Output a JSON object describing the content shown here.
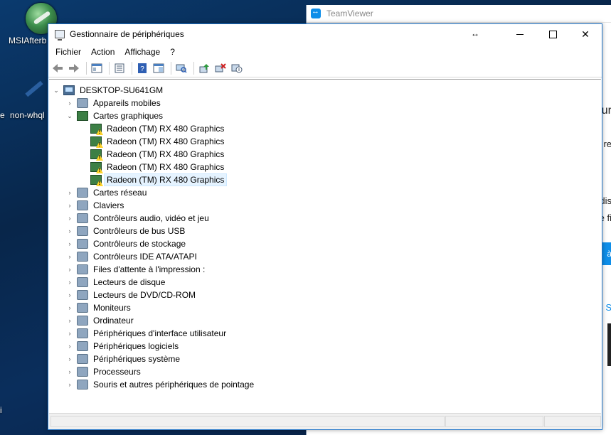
{
  "desktop": {
    "icons": [
      {
        "label": "MSIAfterb"
      },
      {
        "label": "non-whql"
      }
    ],
    "edge_letters": [
      "e",
      "i"
    ]
  },
  "teamviewer": {
    "title": "TeamViewer",
    "fragments": [
      "ur",
      "re",
      "dis",
      "e fi",
      "à",
      "- S"
    ]
  },
  "devmgr": {
    "title": "Gestionnaire de périphériques",
    "menu": [
      "Fichier",
      "Action",
      "Affichage",
      "?"
    ],
    "toolbar_icons": [
      "back-icon",
      "forward-icon",
      "show-hide-console-tree-icon",
      "properties-icon",
      "help-icon",
      "view-icon",
      "scan-hardware-icon",
      "update-driver-icon",
      "uninstall-device-icon",
      "disable-device-icon"
    ],
    "tree": {
      "root": "DESKTOP-SU641GM",
      "items": [
        {
          "label": "Appareils mobiles",
          "icon": "mobile-device-icon",
          "expanded": false
        },
        {
          "label": "Cartes graphiques",
          "icon": "display-adapter-icon",
          "expanded": true,
          "children": [
            "Radeon (TM) RX 480 Graphics",
            "Radeon (TM) RX 480 Graphics",
            "Radeon (TM) RX 480 Graphics",
            "Radeon (TM) RX 480 Graphics",
            "Radeon (TM) RX 480 Graphics"
          ]
        },
        {
          "label": "Cartes réseau",
          "icon": "network-adapter-icon"
        },
        {
          "label": "Claviers",
          "icon": "keyboard-icon"
        },
        {
          "label": "Contrôleurs audio, vidéo et jeu",
          "icon": "audio-icon"
        },
        {
          "label": "Contrôleurs de bus USB",
          "icon": "usb-icon"
        },
        {
          "label": "Contrôleurs de stockage",
          "icon": "storage-controller-icon"
        },
        {
          "label": "Contrôleurs IDE ATA/ATAPI",
          "icon": "ide-controller-icon"
        },
        {
          "label": "Files d'attente à l'impression :",
          "icon": "printer-queue-icon"
        },
        {
          "label": "Lecteurs de disque",
          "icon": "disk-drive-icon"
        },
        {
          "label": "Lecteurs de DVD/CD-ROM",
          "icon": "dvd-drive-icon"
        },
        {
          "label": "Moniteurs",
          "icon": "monitor-icon"
        },
        {
          "label": "Ordinateur",
          "icon": "computer-icon"
        },
        {
          "label": "Périphériques d'interface utilisateur",
          "icon": "hid-icon"
        },
        {
          "label": "Périphériques logiciels",
          "icon": "software-device-icon"
        },
        {
          "label": "Périphériques système",
          "icon": "system-device-icon"
        },
        {
          "label": "Processeurs",
          "icon": "processor-icon"
        },
        {
          "label": "Souris et autres périphériques de pointage",
          "icon": "mouse-icon"
        }
      ],
      "selected_child_index": 4
    }
  }
}
